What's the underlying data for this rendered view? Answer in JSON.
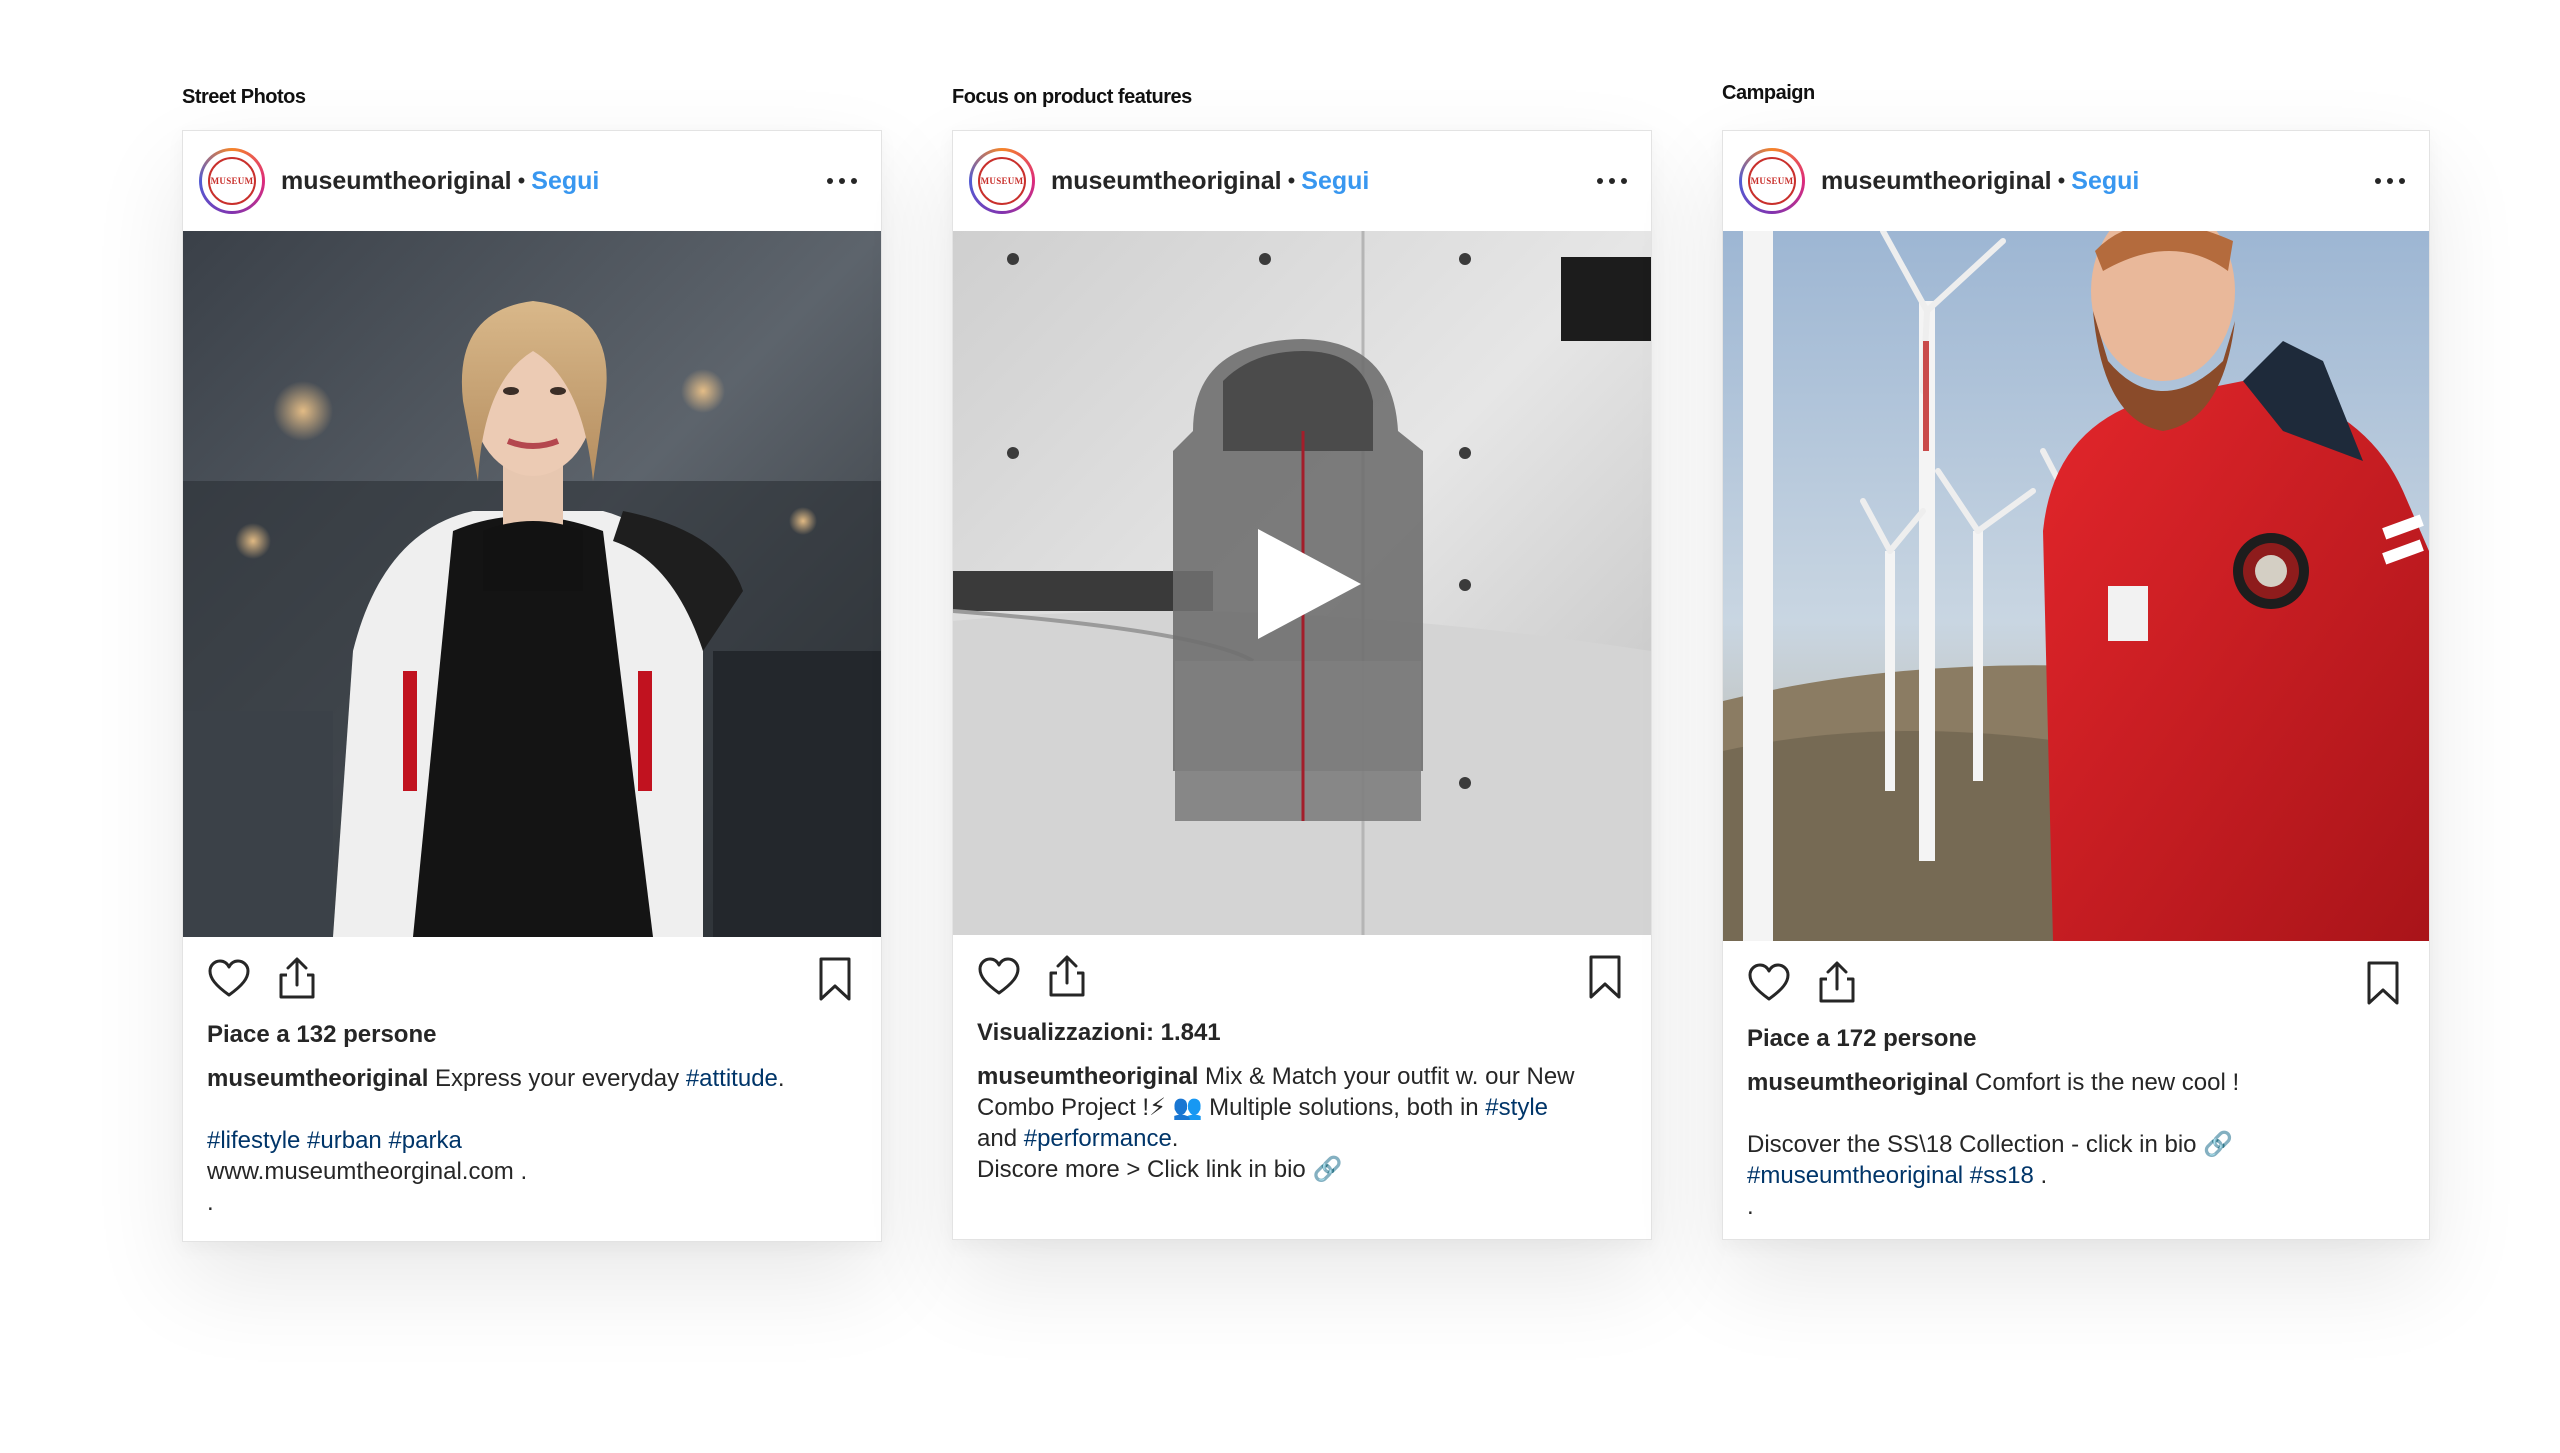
{
  "sections": [
    {
      "label": "Street Photos"
    },
    {
      "label": "Focus on product features"
    },
    {
      "label": "Campaign"
    }
  ],
  "posts": [
    {
      "username": "museumtheoriginal",
      "separator": "•",
      "follow": "Segui",
      "avatar_text": "MUSEUM",
      "likes": "Piace a 132 persone",
      "caption_user": "museumtheoriginal",
      "caption_text": " Express your everyday ",
      "caption_tag": "#attitude",
      "caption_end": ".",
      "tags_line": "#lifestyle #urban #parka",
      "url_line": "www.museumtheorginal.com .",
      "dot_line": "."
    },
    {
      "username": "museumtheoriginal",
      "separator": "•",
      "follow": "Segui",
      "avatar_text": "MUSEUM",
      "views": "Visualizzazioni: 1.841",
      "caption_user": "museumtheoriginal",
      "caption_text": " Mix & Match your outfit w. our New",
      "line2_text": "Combo Project !⚡  👥  Multiple solutions, both in ",
      "line2_tag": "#style",
      "line3_text": "and ",
      "line3_tag": "#performance",
      "line3_end": ".",
      "line4_text": "Discore more > Click link in bio 🔗"
    },
    {
      "username": "museumtheoriginal",
      "separator": "•",
      "follow": "Segui",
      "avatar_text": "MUSEUM",
      "likes": "Piace a 172 persone",
      "caption_user": "museumtheoriginal",
      "caption_text": " Comfort is the new cool !",
      "line2_text": "Discover the SS\\18 Collection - click in bio 🔗",
      "line3_tag": "#museumtheoriginal #ss18",
      "line3_end": " .",
      "dot_line": "."
    }
  ],
  "icons": {
    "like": "heart-icon",
    "share": "share-icon",
    "save": "bookmark-icon",
    "more": "more-dots-icon",
    "play": "play-icon"
  },
  "colors": {
    "follow": "#3897f0",
    "hashtag": "#003569",
    "text": "#262626"
  }
}
